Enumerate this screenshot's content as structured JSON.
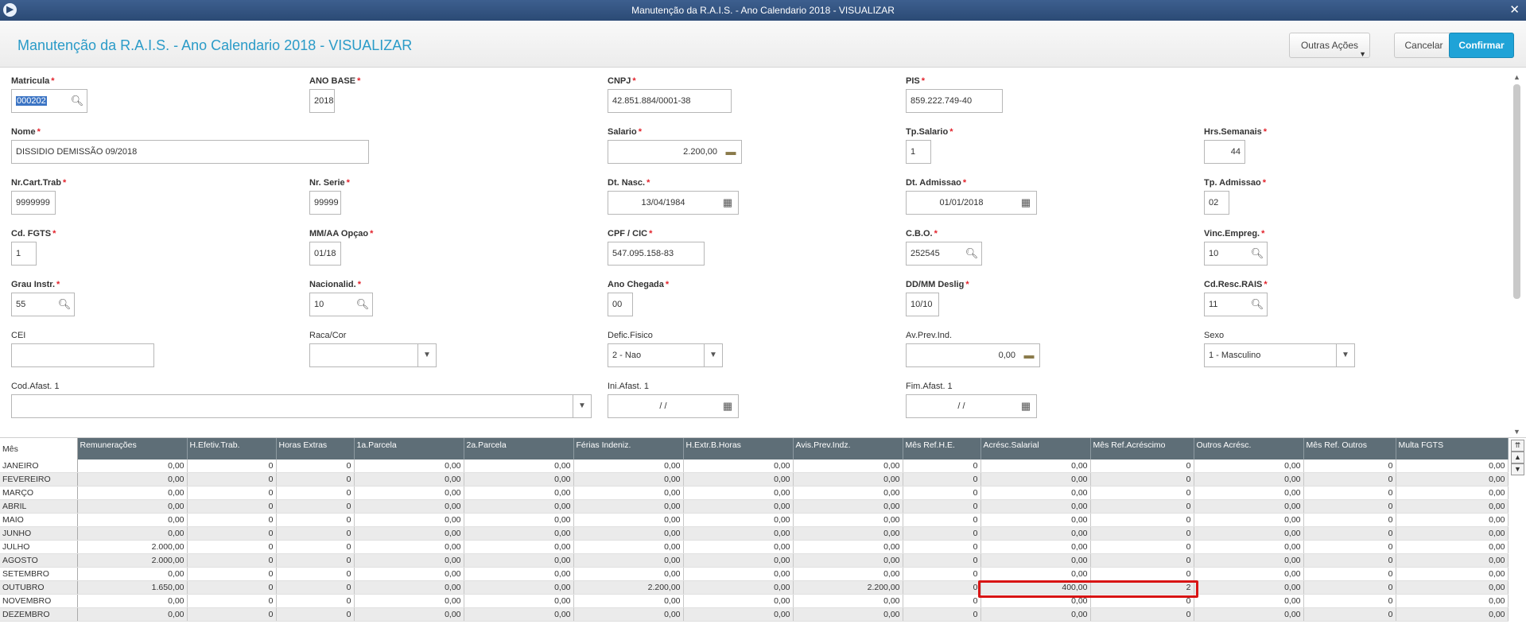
{
  "window": {
    "title": "Manutenção da R.A.I.S. - Ano Calendario 2018 - VISUALIZAR",
    "close": "✕",
    "app_icon": "▶"
  },
  "header": {
    "title": "Manutenção da R.A.I.S. - Ano Calendario 2018 - VISUALIZAR",
    "outras": "Outras Ações",
    "cancel": "Cancelar",
    "confirm": "Confirmar"
  },
  "form": {
    "matricula": {
      "label": "Matricula",
      "value": "000202"
    },
    "ano_base": {
      "label": "ANO BASE",
      "value": "2018"
    },
    "cnpj": {
      "label": "CNPJ",
      "value": "42.851.884/0001-38"
    },
    "pis": {
      "label": "PIS",
      "value": "859.222.749-40"
    },
    "nome": {
      "label": "Nome",
      "value": "DISSIDIO DEMISSÃO 09/2018"
    },
    "salario": {
      "label": "Salario",
      "value": "2.200,00"
    },
    "tp_salario": {
      "label": "Tp.Salario",
      "value": "1"
    },
    "hrs_semanais": {
      "label": "Hrs.Semanais",
      "value": "44"
    },
    "nr_cart_trab": {
      "label": "Nr.Cart.Trab",
      "value": "9999999"
    },
    "nr_serie": {
      "label": "Nr. Serie",
      "value": "99999"
    },
    "dt_nasc": {
      "label": "Dt. Nasc.",
      "value": "13/04/1984"
    },
    "dt_admissao": {
      "label": "Dt. Admissao",
      "value": "01/01/2018"
    },
    "tp_admissao": {
      "label": "Tp. Admissao",
      "value": "02"
    },
    "cd_fgts": {
      "label": "Cd. FGTS",
      "value": "1"
    },
    "mmaa_opcao": {
      "label": "MM/AA Opçao",
      "value": "01/18"
    },
    "cpf_cic": {
      "label": "CPF / CIC",
      "value": "547.095.158-83"
    },
    "cbo": {
      "label": "C.B.O.",
      "value": "252545"
    },
    "vinc_empreg": {
      "label": "Vinc.Empreg.",
      "value": "10"
    },
    "grau_instr": {
      "label": "Grau Instr.",
      "value": "55"
    },
    "nacionalid": {
      "label": "Nacionalid.",
      "value": "10"
    },
    "ano_chegada": {
      "label": "Ano Chegada",
      "value": "00"
    },
    "ddmm_deslig": {
      "label": "DD/MM Deslig",
      "value": "10/10"
    },
    "cd_resc_rais": {
      "label": "Cd.Resc.RAIS",
      "value": "11"
    },
    "cei": {
      "label": "CEI",
      "value": ""
    },
    "raca_cor": {
      "label": "Raca/Cor",
      "value": ""
    },
    "defic_fisico": {
      "label": "Defic.Fisico",
      "value": "2 - Nao"
    },
    "av_prev_ind": {
      "label": "Av.Prev.Ind.",
      "value": "0,00"
    },
    "sexo": {
      "label": "Sexo",
      "value": "1 - Masculino"
    },
    "cod_afast": {
      "label": "Cod.Afast. 1",
      "value": ""
    },
    "ini_afast": {
      "label": "Ini.Afast. 1",
      "value": "/ /"
    },
    "fim_afast": {
      "label": "Fim.Afast. 1",
      "value": "/ /"
    },
    "required_mark": "*"
  },
  "grid": {
    "columns": [
      "Mês",
      "Remunerações",
      "H.Efetiv.Trab.",
      "Horas Extras",
      "1a.Parcela",
      "2a.Parcela",
      "Férias Indeniz.",
      "H.Extr.B.Horas",
      "Avis.Prev.Indz.",
      "Mês Ref.H.E.",
      "Acrésc.Salarial",
      "Mês Ref.Acréscimo",
      "Outros Acrésc.",
      "Mês Ref. Outros",
      "Multa FGTS"
    ],
    "rows": [
      [
        "JANEIRO",
        "0,00",
        "0",
        "0",
        "0,00",
        "0,00",
        "0,00",
        "0,00",
        "0,00",
        "0",
        "0,00",
        "0",
        "0,00",
        "0",
        "0,00"
      ],
      [
        "FEVEREIRO",
        "0,00",
        "0",
        "0",
        "0,00",
        "0,00",
        "0,00",
        "0,00",
        "0,00",
        "0",
        "0,00",
        "0",
        "0,00",
        "0",
        "0,00"
      ],
      [
        "MARÇO",
        "0,00",
        "0",
        "0",
        "0,00",
        "0,00",
        "0,00",
        "0,00",
        "0,00",
        "0",
        "0,00",
        "0",
        "0,00",
        "0",
        "0,00"
      ],
      [
        "ABRIL",
        "0,00",
        "0",
        "0",
        "0,00",
        "0,00",
        "0,00",
        "0,00",
        "0,00",
        "0",
        "0,00",
        "0",
        "0,00",
        "0",
        "0,00"
      ],
      [
        "MAIO",
        "0,00",
        "0",
        "0",
        "0,00",
        "0,00",
        "0,00",
        "0,00",
        "0,00",
        "0",
        "0,00",
        "0",
        "0,00",
        "0",
        "0,00"
      ],
      [
        "JUNHO",
        "0,00",
        "0",
        "0",
        "0,00",
        "0,00",
        "0,00",
        "0,00",
        "0,00",
        "0",
        "0,00",
        "0",
        "0,00",
        "0",
        "0,00"
      ],
      [
        "JULHO",
        "2.000,00",
        "0",
        "0",
        "0,00",
        "0,00",
        "0,00",
        "0,00",
        "0,00",
        "0",
        "0,00",
        "0",
        "0,00",
        "0",
        "0,00"
      ],
      [
        "AGOSTO",
        "2.000,00",
        "0",
        "0",
        "0,00",
        "0,00",
        "0,00",
        "0,00",
        "0,00",
        "0",
        "0,00",
        "0",
        "0,00",
        "0",
        "0,00"
      ],
      [
        "SETEMBRO",
        "0,00",
        "0",
        "0",
        "0,00",
        "0,00",
        "0,00",
        "0,00",
        "0,00",
        "0",
        "0,00",
        "0",
        "0,00",
        "0",
        "0,00"
      ],
      [
        "OUTUBRO",
        "1.650,00",
        "0",
        "0",
        "0,00",
        "0,00",
        "2.200,00",
        "0,00",
        "2.200,00",
        "0",
        "400,00",
        "2",
        "0,00",
        "0",
        "0,00"
      ],
      [
        "NOVEMBRO",
        "0,00",
        "0",
        "0",
        "0,00",
        "0,00",
        "0,00",
        "0,00",
        "0,00",
        "0",
        "0,00",
        "0",
        "0,00",
        "0",
        "0,00"
      ],
      [
        "DEZEMBRO",
        "0,00",
        "0",
        "0",
        "0,00",
        "0,00",
        "0,00",
        "0,00",
        "0,00",
        "0",
        "0,00",
        "0",
        "0,00",
        "0",
        "0,00"
      ]
    ]
  },
  "icons": {
    "search": "search-icon",
    "money": "money-icon",
    "calendar": "calendar-icon",
    "dropdown": "chevron-down-icon"
  },
  "colors": {
    "accent": "#1fa3d7",
    "title": "#2a9bc8",
    "header_grid": "#5e6e77",
    "highlight": "#d81414",
    "required": "#e2222b"
  }
}
